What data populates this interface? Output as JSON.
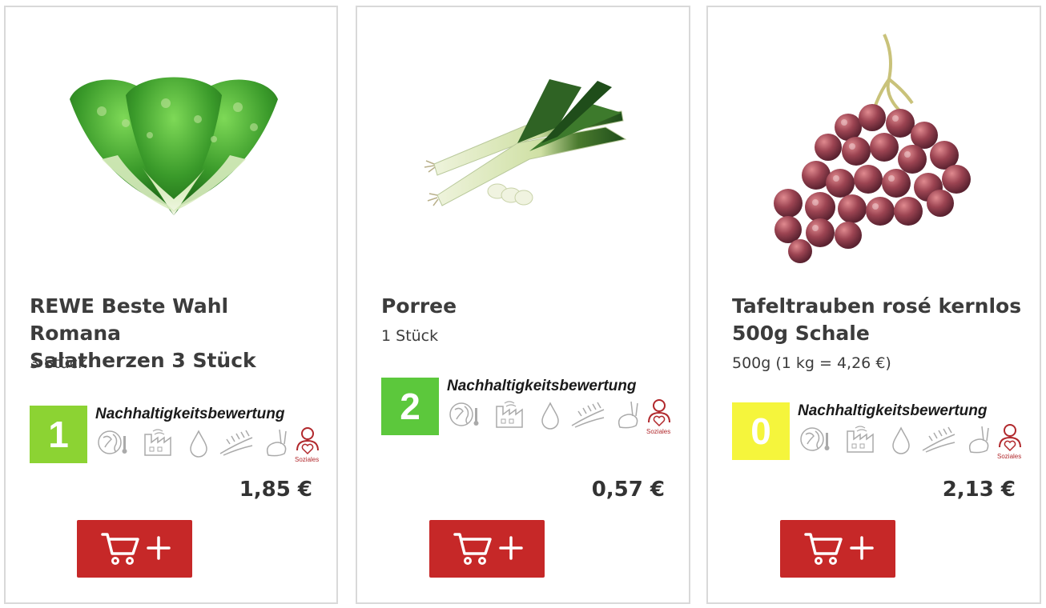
{
  "rating_label": "Nachhaltigkeitsbewertung",
  "social_label": "Soziales",
  "products": [
    {
      "image": "romaine-lettuce-image",
      "title_line1": "REWE Beste Wahl Romana",
      "title_line2": "Salatherzen 3 Stück",
      "subtitle": "3 Stück",
      "score": "1",
      "score_color": "#8cd333",
      "price": "1,85 €"
    },
    {
      "image": "leek-image",
      "title_line1": "Porree",
      "title_line2": "",
      "subtitle": "1 Stück",
      "score": "2",
      "score_color": "#5cc83c",
      "price": "0,57 €"
    },
    {
      "image": "grapes-image",
      "title_line1": "Tafeltrauben rosé kernlos",
      "title_line2": "500g Schale",
      "subtitle": "500g (1 kg = 4,26 €)",
      "score": "0",
      "score_color": "#f5f53c",
      "price": "2,13 €"
    }
  ],
  "colors": {
    "cart_button": "#c62828",
    "social_icon": "#b1282c",
    "card_border": "#d9d9d9"
  },
  "icons": [
    "globe-thermometer-icon",
    "factory-icon",
    "water-drop-icon",
    "wheat-field-icon",
    "rabbit-icon",
    "person-heart-icon",
    "cart-icon",
    "plus-icon"
  ]
}
